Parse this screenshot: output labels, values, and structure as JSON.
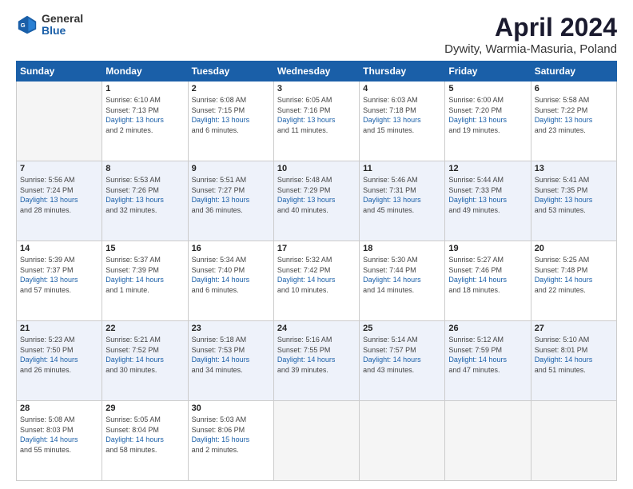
{
  "logo": {
    "general": "General",
    "blue": "Blue"
  },
  "title": "April 2024",
  "subtitle": "Dywity, Warmia-Masuria, Poland",
  "days_of_week": [
    "Sunday",
    "Monday",
    "Tuesday",
    "Wednesday",
    "Thursday",
    "Friday",
    "Saturday"
  ],
  "weeks": [
    [
      {
        "day": "",
        "info": ""
      },
      {
        "day": "1",
        "info": "Sunrise: 6:10 AM\nSunset: 7:13 PM\nDaylight: 13 hours\nand 2 minutes."
      },
      {
        "day": "2",
        "info": "Sunrise: 6:08 AM\nSunset: 7:15 PM\nDaylight: 13 hours\nand 6 minutes."
      },
      {
        "day": "3",
        "info": "Sunrise: 6:05 AM\nSunset: 7:16 PM\nDaylight: 13 hours\nand 11 minutes."
      },
      {
        "day": "4",
        "info": "Sunrise: 6:03 AM\nSunset: 7:18 PM\nDaylight: 13 hours\nand 15 minutes."
      },
      {
        "day": "5",
        "info": "Sunrise: 6:00 AM\nSunset: 7:20 PM\nDaylight: 13 hours\nand 19 minutes."
      },
      {
        "day": "6",
        "info": "Sunrise: 5:58 AM\nSunset: 7:22 PM\nDaylight: 13 hours\nand 23 minutes."
      }
    ],
    [
      {
        "day": "7",
        "info": "Sunrise: 5:56 AM\nSunset: 7:24 PM\nDaylight: 13 hours\nand 28 minutes."
      },
      {
        "day": "8",
        "info": "Sunrise: 5:53 AM\nSunset: 7:26 PM\nDaylight: 13 hours\nand 32 minutes."
      },
      {
        "day": "9",
        "info": "Sunrise: 5:51 AM\nSunset: 7:27 PM\nDaylight: 13 hours\nand 36 minutes."
      },
      {
        "day": "10",
        "info": "Sunrise: 5:48 AM\nSunset: 7:29 PM\nDaylight: 13 hours\nand 40 minutes."
      },
      {
        "day": "11",
        "info": "Sunrise: 5:46 AM\nSunset: 7:31 PM\nDaylight: 13 hours\nand 45 minutes."
      },
      {
        "day": "12",
        "info": "Sunrise: 5:44 AM\nSunset: 7:33 PM\nDaylight: 13 hours\nand 49 minutes."
      },
      {
        "day": "13",
        "info": "Sunrise: 5:41 AM\nSunset: 7:35 PM\nDaylight: 13 hours\nand 53 minutes."
      }
    ],
    [
      {
        "day": "14",
        "info": "Sunrise: 5:39 AM\nSunset: 7:37 PM\nDaylight: 13 hours\nand 57 minutes."
      },
      {
        "day": "15",
        "info": "Sunrise: 5:37 AM\nSunset: 7:39 PM\nDaylight: 14 hours\nand 1 minute."
      },
      {
        "day": "16",
        "info": "Sunrise: 5:34 AM\nSunset: 7:40 PM\nDaylight: 14 hours\nand 6 minutes."
      },
      {
        "day": "17",
        "info": "Sunrise: 5:32 AM\nSunset: 7:42 PM\nDaylight: 14 hours\nand 10 minutes."
      },
      {
        "day": "18",
        "info": "Sunrise: 5:30 AM\nSunset: 7:44 PM\nDaylight: 14 hours\nand 14 minutes."
      },
      {
        "day": "19",
        "info": "Sunrise: 5:27 AM\nSunset: 7:46 PM\nDaylight: 14 hours\nand 18 minutes."
      },
      {
        "day": "20",
        "info": "Sunrise: 5:25 AM\nSunset: 7:48 PM\nDaylight: 14 hours\nand 22 minutes."
      }
    ],
    [
      {
        "day": "21",
        "info": "Sunrise: 5:23 AM\nSunset: 7:50 PM\nDaylight: 14 hours\nand 26 minutes."
      },
      {
        "day": "22",
        "info": "Sunrise: 5:21 AM\nSunset: 7:52 PM\nDaylight: 14 hours\nand 30 minutes."
      },
      {
        "day": "23",
        "info": "Sunrise: 5:18 AM\nSunset: 7:53 PM\nDaylight: 14 hours\nand 34 minutes."
      },
      {
        "day": "24",
        "info": "Sunrise: 5:16 AM\nSunset: 7:55 PM\nDaylight: 14 hours\nand 39 minutes."
      },
      {
        "day": "25",
        "info": "Sunrise: 5:14 AM\nSunset: 7:57 PM\nDaylight: 14 hours\nand 43 minutes."
      },
      {
        "day": "26",
        "info": "Sunrise: 5:12 AM\nSunset: 7:59 PM\nDaylight: 14 hours\nand 47 minutes."
      },
      {
        "day": "27",
        "info": "Sunrise: 5:10 AM\nSunset: 8:01 PM\nDaylight: 14 hours\nand 51 minutes."
      }
    ],
    [
      {
        "day": "28",
        "info": "Sunrise: 5:08 AM\nSunset: 8:03 PM\nDaylight: 14 hours\nand 55 minutes."
      },
      {
        "day": "29",
        "info": "Sunrise: 5:05 AM\nSunset: 8:04 PM\nDaylight: 14 hours\nand 58 minutes."
      },
      {
        "day": "30",
        "info": "Sunrise: 5:03 AM\nSunset: 8:06 PM\nDaylight: 15 hours\nand 2 minutes."
      },
      {
        "day": "",
        "info": ""
      },
      {
        "day": "",
        "info": ""
      },
      {
        "day": "",
        "info": ""
      },
      {
        "day": "",
        "info": ""
      }
    ]
  ]
}
